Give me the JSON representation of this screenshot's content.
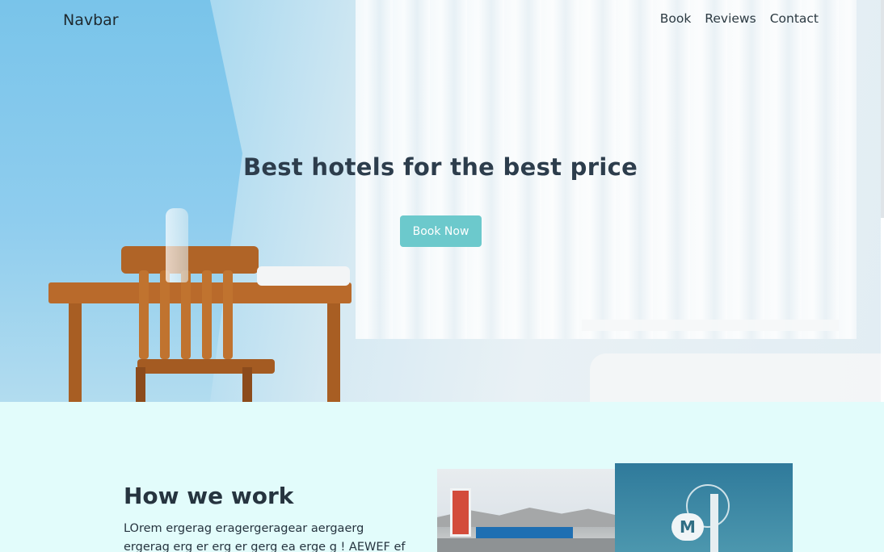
{
  "navbar": {
    "brand": "Navbar",
    "links": [
      "Book",
      "Reviews",
      "Contact"
    ]
  },
  "hero": {
    "title": "Best hotels for the best price",
    "cta_label": "Book Now"
  },
  "section": {
    "title": "How we work",
    "text": "LOrem ergerag eragergeragear aergaerg ergerag erg er erg er gerg ea erge g ! AEWEF ef"
  },
  "photos": {
    "sign_badge": "M"
  },
  "colors": {
    "accent_button": "#6cc9cc",
    "section_bg": "#e2fcfb",
    "title_text": "#2d3d4c"
  }
}
